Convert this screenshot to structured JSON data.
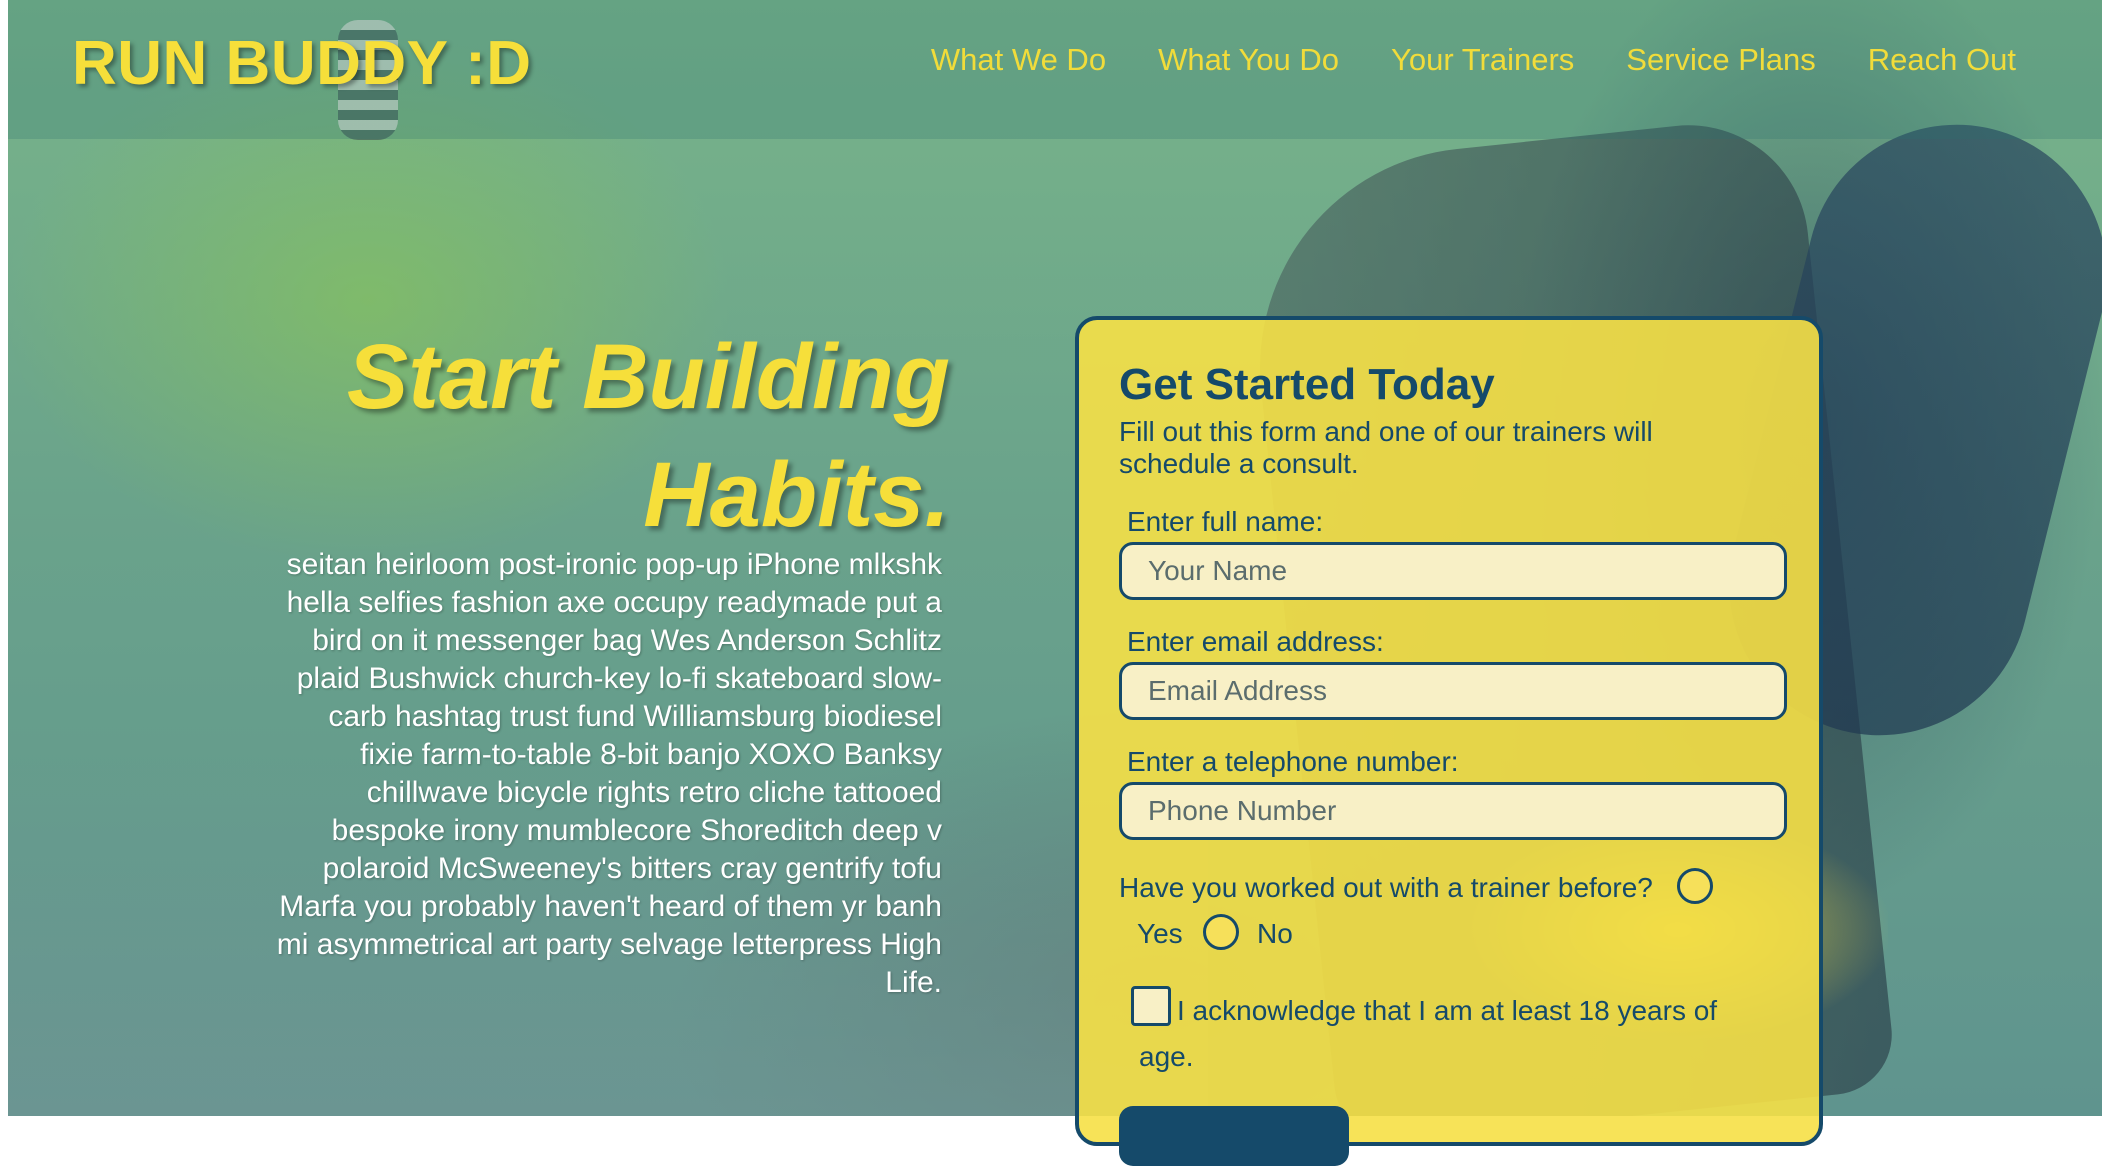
{
  "brand": "RUN BUDDY :D",
  "nav": [
    {
      "label": "What We Do"
    },
    {
      "label": "What You Do"
    },
    {
      "label": "Your Trainers"
    },
    {
      "label": "Service Plans"
    },
    {
      "label": "Reach Out"
    }
  ],
  "hero": {
    "title_line1": "Start Building",
    "title_line2": "Habits.",
    "body": "seitan heirloom post-ironic pop-up iPhone mlkshk hella selfies fashion axe occupy readymade put a bird on it messenger bag Wes Anderson Schlitz plaid Bushwick church-key lo-fi skateboard slow-carb hashtag trust fund Williamsburg biodiesel fixie farm-to-table 8-bit banjo XOXO Banksy chillwave bicycle rights retro cliche tattooed bespoke irony mumblecore Shoreditch deep v polaroid McSweeney's bitters cray gentrify tofu Marfa you probably haven't heard of them yr banh mi asymmetrical art party selvage letterpress High Life."
  },
  "form": {
    "title": "Get Started Today",
    "subtitle": "Fill out this form and one of our trainers will schedule a consult.",
    "name_label": "Enter full name:",
    "name_placeholder": "Your Name",
    "email_label": "Enter email address:",
    "email_placeholder": "Email Address",
    "phone_label": "Enter a telephone number:",
    "phone_placeholder": "Phone Number",
    "trainer_question": "Have you worked out with a trainer before?",
    "yes_label": "Yes",
    "no_label": "No",
    "ack_label": "I acknowledge that I am at least 18 years of age."
  },
  "colors": {
    "accent_yellow": "#f6df3a",
    "brand_navy": "#154a6a",
    "input_fill": "#f8f0c6"
  }
}
